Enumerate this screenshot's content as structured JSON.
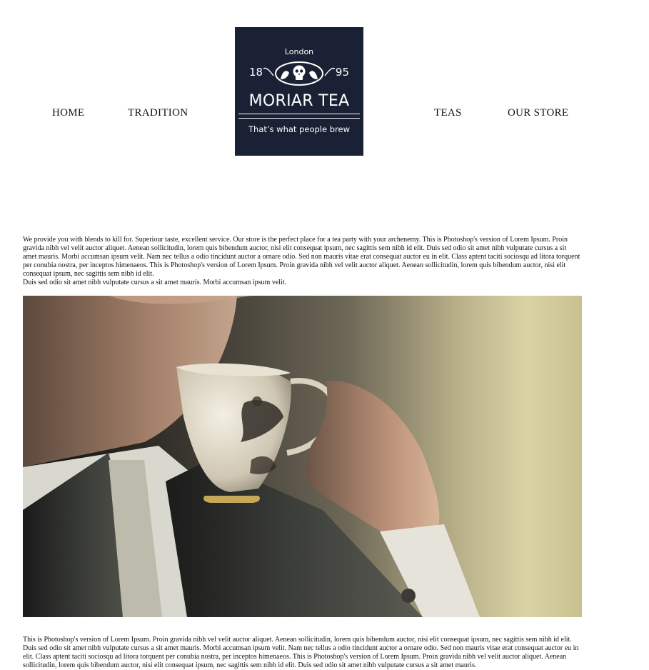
{
  "nav": {
    "home": "HOME",
    "tradition": "TRADITION",
    "teas": "TEAS",
    "store": "OUR STORE"
  },
  "logo": {
    "city": "London",
    "year_left": "18",
    "year_right": "95",
    "name": "MORIAR TEA",
    "tagline": "That’s what people brew",
    "icon": "skull-emblem-icon"
  },
  "intro": {
    "text": "We provide you with blends to kill for. Superiour taste, excellent service. Our store is the perfect place for a tea party with your archenemy. This is Photoshop's version of  Lorem Ipsum. Proin gravida nibh vel velit auctor aliquet. Aenean sollicitudin, lorem quis bibendum auctor, nisi elit consequat ipsum, nec sagittis sem nibh id elit. Duis sed odio sit amet nibh vulputate cursus a sit amet mauris. Morbi accumsan ipsum velit. Nam nec tellus a odio tincidunt auctor a ornare odio. Sed non mauris vitae erat consequat auctor eu in elit. Class aptent taciti sociosqu ad litora torquent per conubia nostra, per inceptos himenaeos. This is Photoshop's version of  Lorem Ipsum. Proin gravida nibh vel velit auctor aliquet. Aenean sollicitudin, lorem quis bibendum auctor, nisi elit consequat ipsum, nec sagittis sem nibh id elit.",
    "text2": "Duis sed odio sit amet nibh vulputate cursus a sit amet mauris. Morbi accumsan ipsum velit."
  },
  "bottom": {
    "text": "This is Photoshop's version of  Lorem Ipsum. Proin gravida nibh vel velit auctor aliquet. Aenean sollicitudin, lorem quis bibendum auctor, nisi elit consequat ipsum, nec sagittis sem nibh id elit. Duis sed odio sit amet nibh vulputate cursus a sit amet mauris. Morbi accumsan ipsum velit. Nam nec tellus a odio tincidunt auctor a ornare odio. Sed non mauris vitae erat consequat auctor eu in elit. Class aptent taciti sociosqu ad litora torquent per conubia nostra, per inceptos himenaeos. This is Photoshop's version of  Lorem Ipsum. Proin gravida nibh vel velit auctor aliquet. Aenean sollicitudin, lorem quis bibendum auctor, nisi elit consequat ipsum, nec sagittis sem nibh id elit. Duis sed odio sit amet nibh vulputate cursus a sit amet mauris."
  },
  "colors": {
    "logo_bg": "#1b2135",
    "text": "#111111"
  }
}
